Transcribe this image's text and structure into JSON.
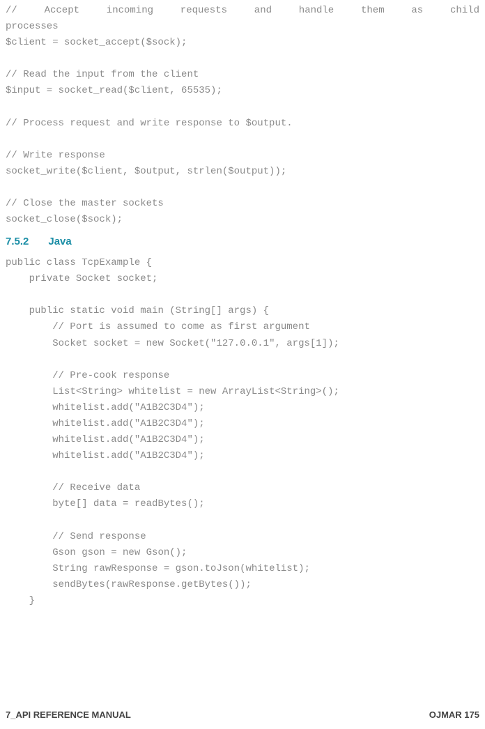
{
  "php_code": {
    "l1": "//  Accept  incoming  requests  and  handle  them  as  child",
    "l2": "processes",
    "l3": "$client = socket_accept($sock);",
    "blank1": "",
    "l4": "// Read the input from the client",
    "l5": "$input = socket_read($client, 65535);",
    "blank2": "",
    "l6": "// Process request and write response to $output.",
    "blank3": "",
    "l7": "// Write response",
    "l8": "socket_write($client, $output, strlen($output));",
    "blank4": "",
    "l9": "// Close the master sockets",
    "l10": "socket_close($sock);"
  },
  "heading": {
    "number": "7.5.2",
    "title": "Java"
  },
  "java_code": {
    "l1": "public class TcpExample {",
    "l2": "    private Socket socket;",
    "blank1": "",
    "l3": "    public static void main (String[] args) {",
    "l4": "        // Port is assumed to come as first argument",
    "l5": "        Socket socket = new Socket(\"127.0.0.1\", args[1]);",
    "blank2": "",
    "l6": "        // Pre-cook response",
    "l7": "        List<String> whitelist = new ArrayList<String>();",
    "l8": "        whitelist.add(\"A1B2C3D4\");",
    "l9": "        whitelist.add(\"A1B2C3D4\");",
    "l10": "        whitelist.add(\"A1B2C3D4\");",
    "l11": "        whitelist.add(\"A1B2C3D4\");",
    "blank3": "",
    "l12": "        // Receive data",
    "l13": "        byte[] data = readBytes();",
    "blank4": "",
    "l14": "        // Send response",
    "l15": "        Gson gson = new Gson();",
    "l16": "        String rawResponse = gson.toJson(whitelist);",
    "l17": "        sendBytes(rawResponse.getBytes());",
    "l18": "    }"
  },
  "footer": {
    "left": "7_API REFERENCE MANUAL",
    "right": "OJMAR 175"
  }
}
